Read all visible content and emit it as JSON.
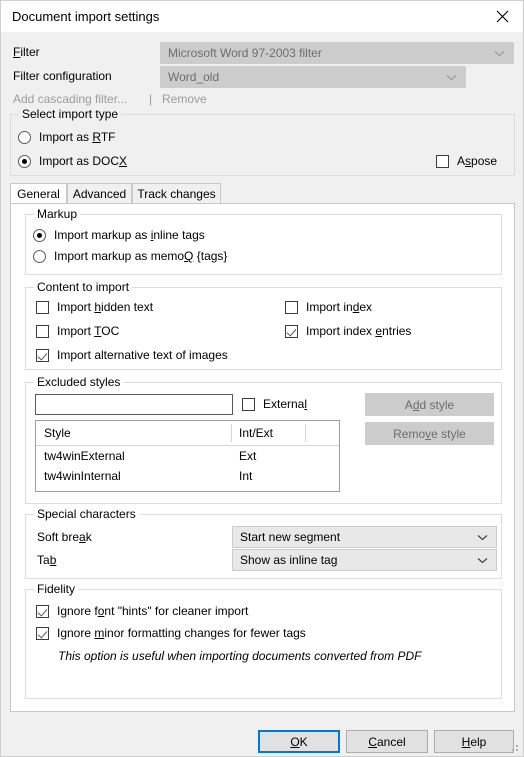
{
  "window": {
    "title": "Document import settings",
    "close_icon": "close-icon"
  },
  "top_form": {
    "filter_label": "Filter",
    "filter_value": "Microsoft Word 97-2003 filter",
    "filter_config_label": "Filter configuration",
    "filter_config_value": "Word_old",
    "add_cascading_filter_label": "Add cascading filter...",
    "separator": "|",
    "remove_label": "Remove"
  },
  "import_type": {
    "legend": "Select import type",
    "options": [
      {
        "label_pre": "Import as ",
        "accel": "R",
        "label_post": "TF",
        "checked": false
      },
      {
        "label_pre": "Import as DOC",
        "accel": "X",
        "label_post": "",
        "checked": true
      }
    ],
    "aspose": {
      "label_pre": "A",
      "accel": "s",
      "label_post": "pose",
      "checked": false
    }
  },
  "tabs": [
    {
      "label": "General",
      "active": true
    },
    {
      "label": "Advanced",
      "active": false
    },
    {
      "label": "Track changes",
      "active": false
    }
  ],
  "markup": {
    "legend": "Markup",
    "options": [
      {
        "label_pre": "Import markup as ",
        "accel": "i",
        "label_post": "nline tags",
        "checked": true
      },
      {
        "label_pre": "Import markup as memo",
        "accel": "Q",
        "label_post": " {tags}",
        "checked": false
      }
    ]
  },
  "content_to_import": {
    "legend": "Content to import",
    "left": [
      {
        "label_pre": "Import ",
        "accel": "h",
        "label_post": "idden text",
        "checked": false
      },
      {
        "label_pre": "Import ",
        "accel": "T",
        "label_post": "OC",
        "checked": false
      },
      {
        "label_pre": "Import alternative text of images",
        "accel": "",
        "label_post": "",
        "checked": true
      }
    ],
    "right": [
      {
        "label_pre": "Import in",
        "accel": "d",
        "label_post": "ex",
        "checked": false
      },
      {
        "label_pre": "Import index ",
        "accel": "e",
        "label_post": "ntries",
        "checked": true
      }
    ]
  },
  "excluded_styles": {
    "legend": "Excluded styles",
    "input_value": "",
    "input_placeholder": "",
    "external": {
      "label_pre": "External",
      "accel": "",
      "label_post": "",
      "checked": false
    },
    "add_style_label_pre": "A",
    "add_style_accel": "d",
    "add_style_label_post": "d style",
    "remove_style_label_pre": "Remo",
    "remove_style_accel": "v",
    "remove_style_label_post": "e style",
    "columns": [
      "Style",
      "Int/Ext"
    ],
    "rows": [
      {
        "style": "tw4winExternal",
        "intext": "Ext"
      },
      {
        "style": "tw4winInternal",
        "intext": "Int"
      }
    ]
  },
  "special_characters": {
    "legend": "Special characters",
    "soft_break": {
      "label_pre": "Soft bre",
      "accel": "a",
      "label_post": "k",
      "value": "Start new segment"
    },
    "tab": {
      "label_pre": "Ta",
      "accel": "b",
      "label_post": "",
      "value": "Show as inline tag"
    }
  },
  "fidelity": {
    "legend": "Fidelity",
    "options": [
      {
        "label_pre": "Ignore f",
        "accel": "o",
        "label_post": "nt \"hints\" for cleaner import",
        "checked": true
      },
      {
        "label_pre": "Ignore ",
        "accel": "m",
        "label_post": "inor formatting changes for fewer tags",
        "checked": true
      }
    ],
    "note": "This option is useful when importing documents converted from PDF"
  },
  "footer": {
    "ok": {
      "pre": "",
      "accel": "O",
      "post": "K"
    },
    "cancel": {
      "pre": "",
      "accel": "C",
      "post": "ancel"
    },
    "help": {
      "pre": "",
      "accel": "H",
      "post": "elp"
    }
  },
  "colors": {
    "dialog_bg": "#f0f0f0",
    "panel_bg": "#ffffff",
    "accent": "#0078d7",
    "disabled_bg": "#cccccc",
    "disabled_text": "#6d6d6d",
    "group_border": "#dcdcdc"
  }
}
